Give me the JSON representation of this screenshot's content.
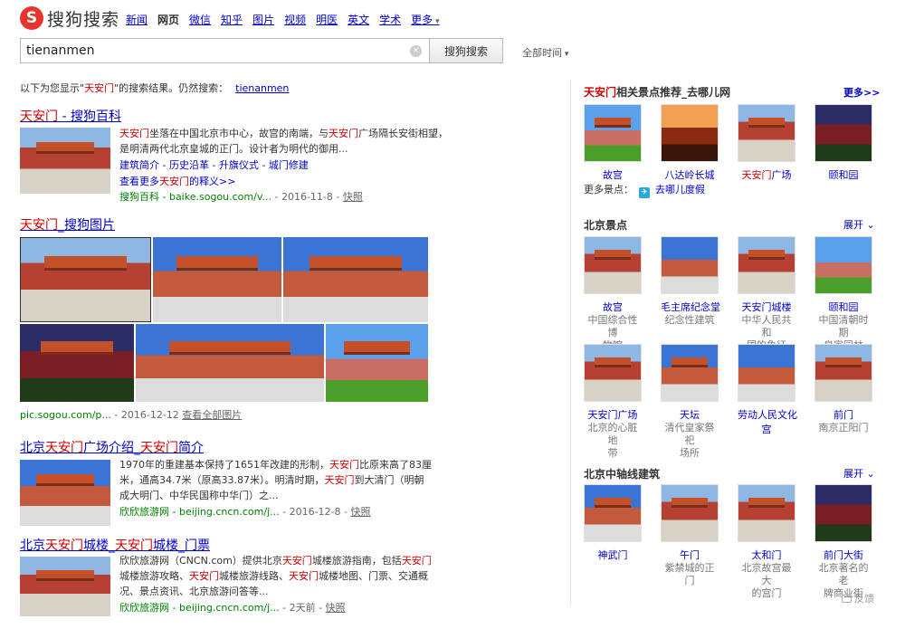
{
  "header": {
    "logo_mark": "S",
    "logo_text": "搜狗搜索",
    "nav": [
      {
        "label": "新闻",
        "active": false
      },
      {
        "label": "网页",
        "active": true
      },
      {
        "label": "微信",
        "active": false
      },
      {
        "label": "知乎",
        "active": false
      },
      {
        "label": "图片",
        "active": false
      },
      {
        "label": "视频",
        "active": false
      },
      {
        "label": "明医",
        "active": false
      },
      {
        "label": "英文",
        "active": false
      },
      {
        "label": "学术",
        "active": false
      },
      {
        "label": "更多",
        "active": false
      }
    ],
    "search_value": "tienanmen",
    "clear_icon": "×",
    "search_button": "搜狗搜索",
    "time_filter": "全部时间"
  },
  "notice": {
    "prefix": "以下为您显示\"",
    "keyword": "天安门",
    "suffix": "\"的搜索结果。仍然搜索：",
    "original_query": "tienanmen"
  },
  "results": {
    "r1": {
      "title_kw": "天安门",
      "title_rest": " - 搜狗百科",
      "snippet_kw1": "天安门",
      "snippet_1": "坐落在中国北京市中心，故宫的南端，与",
      "snippet_kw2": "天安门",
      "snippet_2": "广场隔长安街相望，是明清两代北京皇城的正门。设计者为明代的御用...",
      "sublinks": "建筑简介 - 历史沿革 - 升旗仪式 - 城门修建",
      "more_prefix": "查看更多",
      "more_kw": "天安门",
      "more_suffix": "的释义>>",
      "url": "搜狗百科 - baike.sogou.com/v...",
      "date": " - 2016-11-8 - ",
      "snap": "快照"
    },
    "r2": {
      "title_kw": "天安门",
      "title_rest": "_搜狗图片",
      "url": "pic.sogou.com/p...",
      "date": " - 2016-12-12 ",
      "view_all": "查看全部图片"
    },
    "r3": {
      "title_a": "北京",
      "title_kw1": "天安门",
      "title_b": "广场介绍_",
      "title_kw2": "天安门",
      "title_c": "简介",
      "line1": "1970年的重建基本保持了1651年改建的形制，",
      "kw1": "天安门",
      "line1b": "比原来高了83厘米，通高34.7米（原高33.87米）。明清时期，",
      "kw2": "天安门",
      "line2": "到大清门（明朝成大明门、中华民国称中华门）之...",
      "url": "欣欣旅游网 - beijing.cncn.com/j...",
      "date": " - 2016-12-8 - ",
      "snap": "快照"
    },
    "r4": {
      "title_a": "北京",
      "title_kw1": "天安门",
      "title_b": "城楼_",
      "title_kw2": "天安门",
      "title_c": "城楼_门票",
      "line1": "欣欣旅游网（CNCN.com）提供北京",
      "kw1": "天安门",
      "line1b": "城楼旅游指南，包括",
      "kw2": "天安门",
      "line2": "城楼旅游攻略、",
      "kw3": "天安门",
      "line2b": "城楼旅游线路、",
      "kw4": "天安门",
      "line3": "城楼地图、门票、交通概况、景点资讯、北京旅游问答等...",
      "url": "欣欣旅游网 - beijing.cncn.com/j...",
      "date": " - 2天前 - ",
      "snap": "快照"
    }
  },
  "sidebar": {
    "related": {
      "title_kw": "天安门",
      "title_rest": "相关景点推荐_去哪儿网",
      "more": "更多>>",
      "items": [
        {
          "name": "故宫",
          "kw": ""
        },
        {
          "name": "八达岭长城",
          "kw": ""
        },
        {
          "name": "广场",
          "kw": "天安门"
        },
        {
          "name": "颐和园",
          "kw": ""
        }
      ],
      "more_spots_label": "更多景点：",
      "qunar_icon": "✈",
      "qunar_link": "去哪儿度假"
    },
    "beijing": {
      "title": "北京景点",
      "toggle": "展开",
      "items": [
        {
          "name": "故宫",
          "desc": [
            "中国综合性博",
            "物馆"
          ]
        },
        {
          "name": "毛主席纪念堂",
          "desc": [
            "纪念性建筑"
          ]
        },
        {
          "name": "天安门城楼",
          "desc": [
            "中华人民共和",
            "国的象征"
          ]
        },
        {
          "name": "颐和园",
          "desc": [
            "中国清朝时期",
            "皇家园林"
          ]
        },
        {
          "name": "天安门广场",
          "desc": [
            "北京的心脏地",
            "带"
          ]
        },
        {
          "name": "天坛",
          "desc": [
            "清代皇家祭祀",
            "场所"
          ]
        },
        {
          "name": "劳动人民文化",
          "desc": [
            "宫"
          ],
          "desc_link": true
        },
        {
          "name": "前门",
          "desc": [
            "南京正阳门"
          ]
        }
      ]
    },
    "axis": {
      "title": "北京中轴线建筑",
      "toggle": "展开",
      "items": [
        {
          "name": "神武门",
          "desc": []
        },
        {
          "name": "午门",
          "desc": [
            "紫禁城的正门"
          ]
        },
        {
          "name": "太和门",
          "desc": [
            "北京故宫最大",
            "的宫门"
          ]
        },
        {
          "name": "前门大街",
          "desc": [
            "北京著名的老",
            "牌商业街"
          ]
        }
      ]
    },
    "feedback": "反馈"
  }
}
